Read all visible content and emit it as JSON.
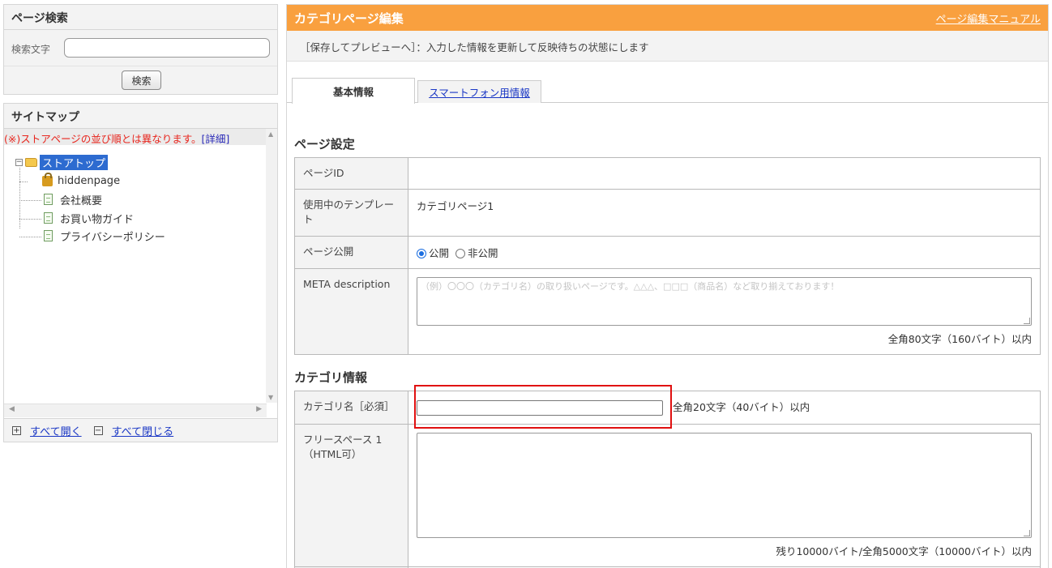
{
  "search": {
    "title": "ページ検索",
    "label": "検索文字",
    "input_value": "",
    "button": "検索"
  },
  "sitemap": {
    "title": "サイトマップ",
    "note_text": "(※)ストアページの並び順とは異なります。",
    "note_link": "[詳細]",
    "tree": {
      "root": "ストアトップ",
      "children": [
        "hiddenpage",
        "会社概要",
        "お買い物ガイド",
        "プライバシーポリシー"
      ]
    },
    "expand_all": "すべて開く",
    "collapse_all": "すべて閉じる"
  },
  "main": {
    "title": "カテゴリページ編集",
    "manual_link": "ページ編集マニュアル",
    "preview_note": "［保存してプレビューへ］：入力した情報を更新して反映待ちの状態にします",
    "tabs": [
      "基本情報",
      "スマートフォン用情報"
    ],
    "page_settings": {
      "title": "ページ設定",
      "page_id_label": "ページID",
      "page_id_value": "",
      "template_label": "使用中のテンプレート",
      "template_value": "カテゴリページ1",
      "publish_label": "ページ公開",
      "publish_on": "公開",
      "publish_off": "非公開",
      "publish_selected": "公開",
      "meta_label": "META description",
      "meta_placeholder": "（例）〇〇〇（カテゴリ名）の取り扱いページです。△△△、□□□（商品名）など取り揃えております！",
      "meta_hint": "全角80文字（160バイト）以内"
    },
    "category_info": {
      "title": "カテゴリ情報",
      "name_label": "カテゴリ名［必須］",
      "name_value": "",
      "name_hint": "全角20文字（40バイト）以内",
      "free_label_1": "フリースペース 1",
      "free_label_2": "（HTML可）",
      "free_hint": "残り10000バイト/全角5000文字（10000バイト）以内"
    }
  },
  "colors": {
    "header_orange": "#f9a03f",
    "link_blue": "#1a37c5",
    "note_red": "#e8261e",
    "highlight_box": "#e01010"
  }
}
